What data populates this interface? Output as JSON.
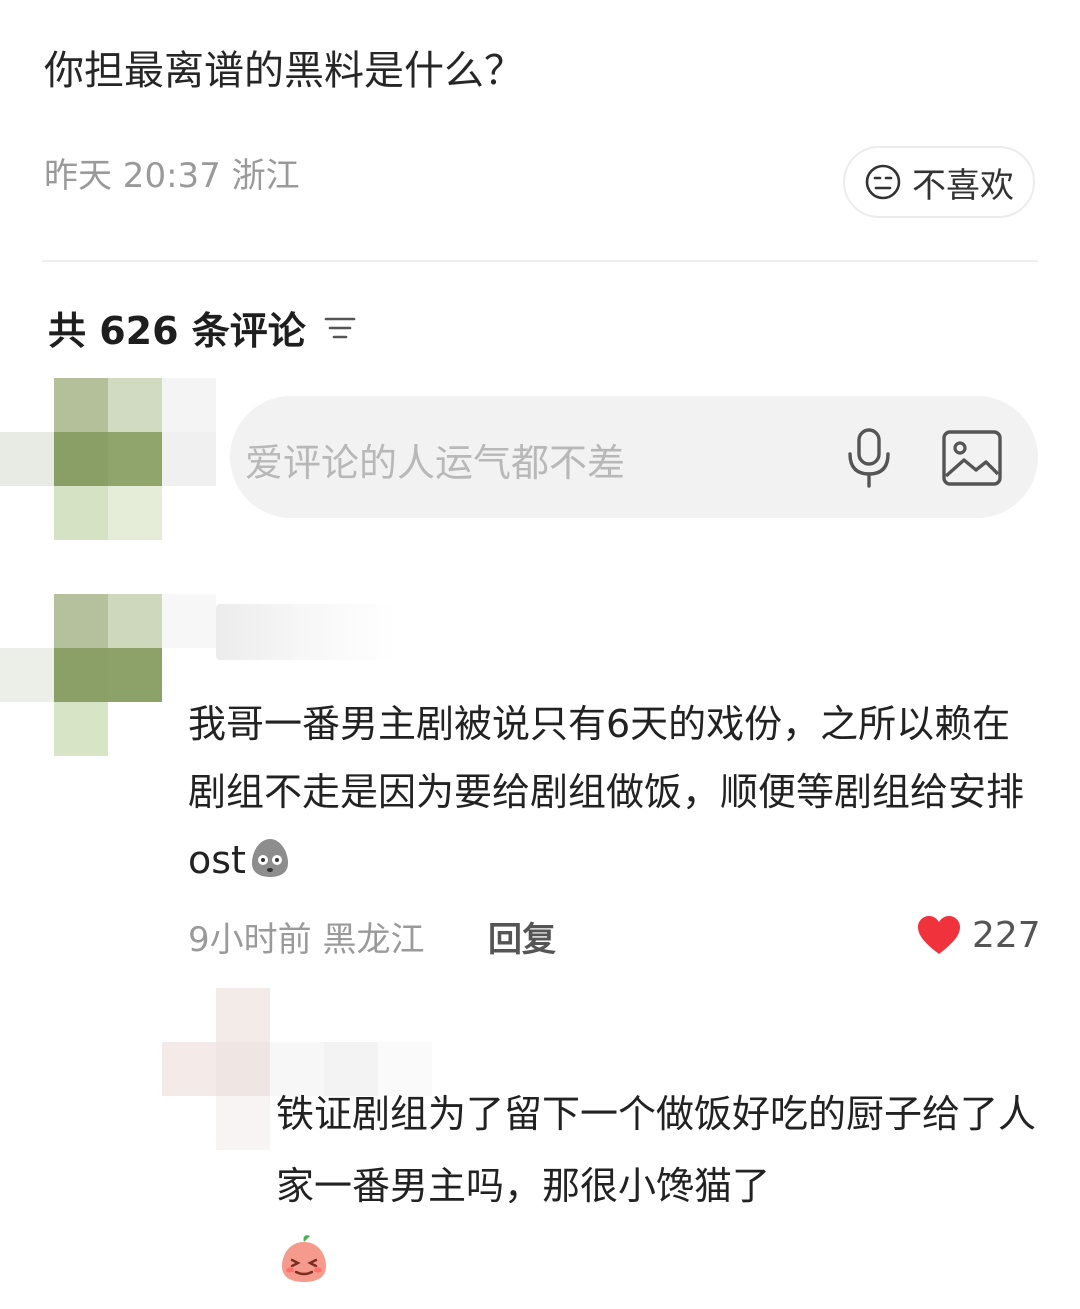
{
  "post": {
    "title": "你担最离谱的黑料是什么？",
    "meta": "昨天 20:37 浙江",
    "dislike_label": "不喜欢"
  },
  "comments_header": {
    "count_label": "共 626 条评论"
  },
  "input": {
    "placeholder": "爱评论的人运气都不差"
  },
  "comment": {
    "text": "我哥一番男主剧被说只有6天的戏份，之所以赖在剧组不走是因为要给剧组做饭，顺便等剧组给安排ost",
    "meta": "9小时前 黑龙江",
    "reply_label": "回复",
    "likes": "227"
  },
  "reply": {
    "text": "铁证剧组为了留下一个做饭好吃的厨子给了人家一番男主吗，那很小馋猫了"
  },
  "colors": {
    "like_red": "#f0323c",
    "avatar_green": "#8ba06a"
  }
}
